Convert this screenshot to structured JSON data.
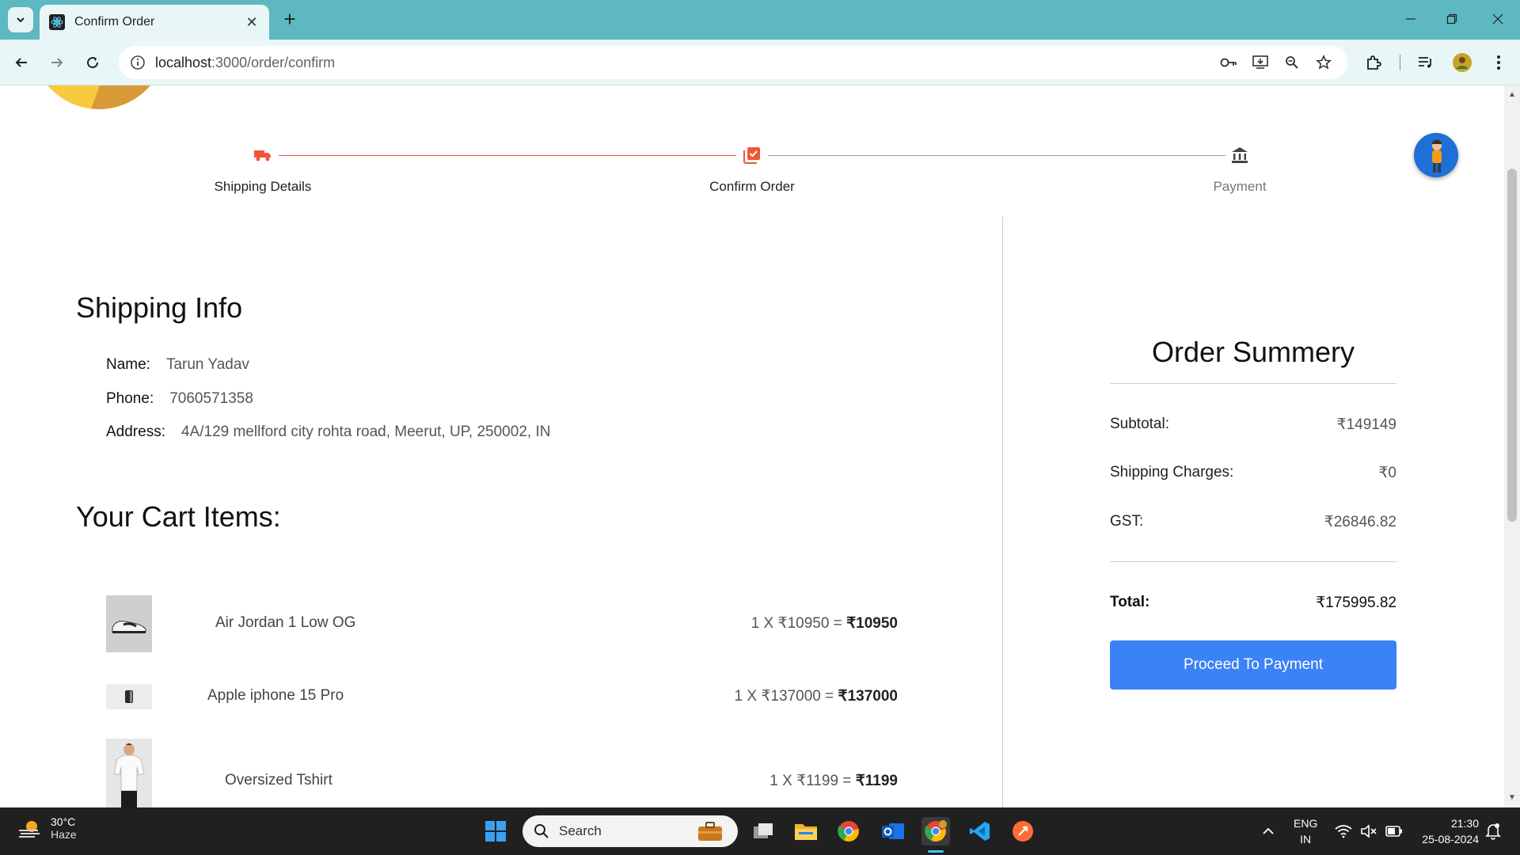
{
  "browser": {
    "tab_title": "Confirm Order",
    "url_host": "localhost",
    "url_path": ":3000/order/confirm"
  },
  "stepper": {
    "steps": [
      {
        "label": "Shipping Details",
        "state": "done"
      },
      {
        "label": "Confirm Order",
        "state": "active"
      },
      {
        "label": "Payment",
        "state": "inactive"
      }
    ]
  },
  "shipping": {
    "title": "Shipping Info",
    "name_label": "Name:",
    "name_value": "Tarun Yadav",
    "phone_label": "Phone:",
    "phone_value": "7060571358",
    "address_label": "Address:",
    "address_value": "4A/129 mellford city rohta road, Meerut, UP, 250002, IN"
  },
  "cart": {
    "title": "Your Cart Items:",
    "items": [
      {
        "name": "Air Jordan 1 Low OG",
        "price_prefix": "1 X ₹10950 = ",
        "total": "₹10950"
      },
      {
        "name": "Apple iphone 15 Pro",
        "price_prefix": "1 X ₹137000 = ",
        "total": "₹137000"
      },
      {
        "name": "Oversized Tshirt",
        "price_prefix": "1 X ₹1199 = ",
        "total": "₹1199"
      }
    ]
  },
  "summary": {
    "title": "Order Summery",
    "subtotal_label": "Subtotal:",
    "subtotal_value": "₹149149",
    "shipping_label": "Shipping Charges:",
    "shipping_value": "₹0",
    "gst_label": "GST:",
    "gst_value": "₹26846.82",
    "total_label": "Total:",
    "total_value": "₹175995.82",
    "button_label": "Proceed To Payment"
  },
  "taskbar": {
    "temp": "30°C",
    "weather": "Haze",
    "search_placeholder": "Search",
    "lang_top": "ENG",
    "lang_bottom": "IN",
    "time": "21:30",
    "date": "25-08-2024"
  },
  "colors": {
    "accent_red": "#f0563a",
    "button_blue": "#3b82f6",
    "chrome_teal": "#5db8c2"
  }
}
